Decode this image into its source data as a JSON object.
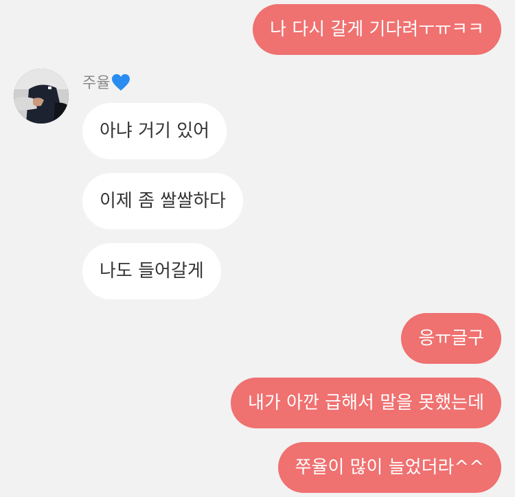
{
  "contact": {
    "name": "주율",
    "name_emoji": "blue-heart-icon",
    "avatar": "avatar-photo"
  },
  "messages": [
    {
      "side": "out",
      "text": "나 다시 갈게 기다려ㅜㅠㅋㅋ"
    },
    {
      "side": "in",
      "text": "아냐 거기 있어"
    },
    {
      "side": "in",
      "text": "이제 좀 쌀쌀하다"
    },
    {
      "side": "in",
      "text": "나도 들어갈게"
    },
    {
      "side": "out",
      "text": "응ㅠ글구"
    },
    {
      "side": "out",
      "text": "내가 아깐 급해서 말을 못했는데"
    },
    {
      "side": "out",
      "text": "쭈율이 많이 늘었더라^^"
    }
  ],
  "colors": {
    "background": "#f2f2f2",
    "outgoing_bubble": "#ef7170",
    "incoming_bubble": "#ffffff",
    "heart": "#2a8cf0"
  }
}
